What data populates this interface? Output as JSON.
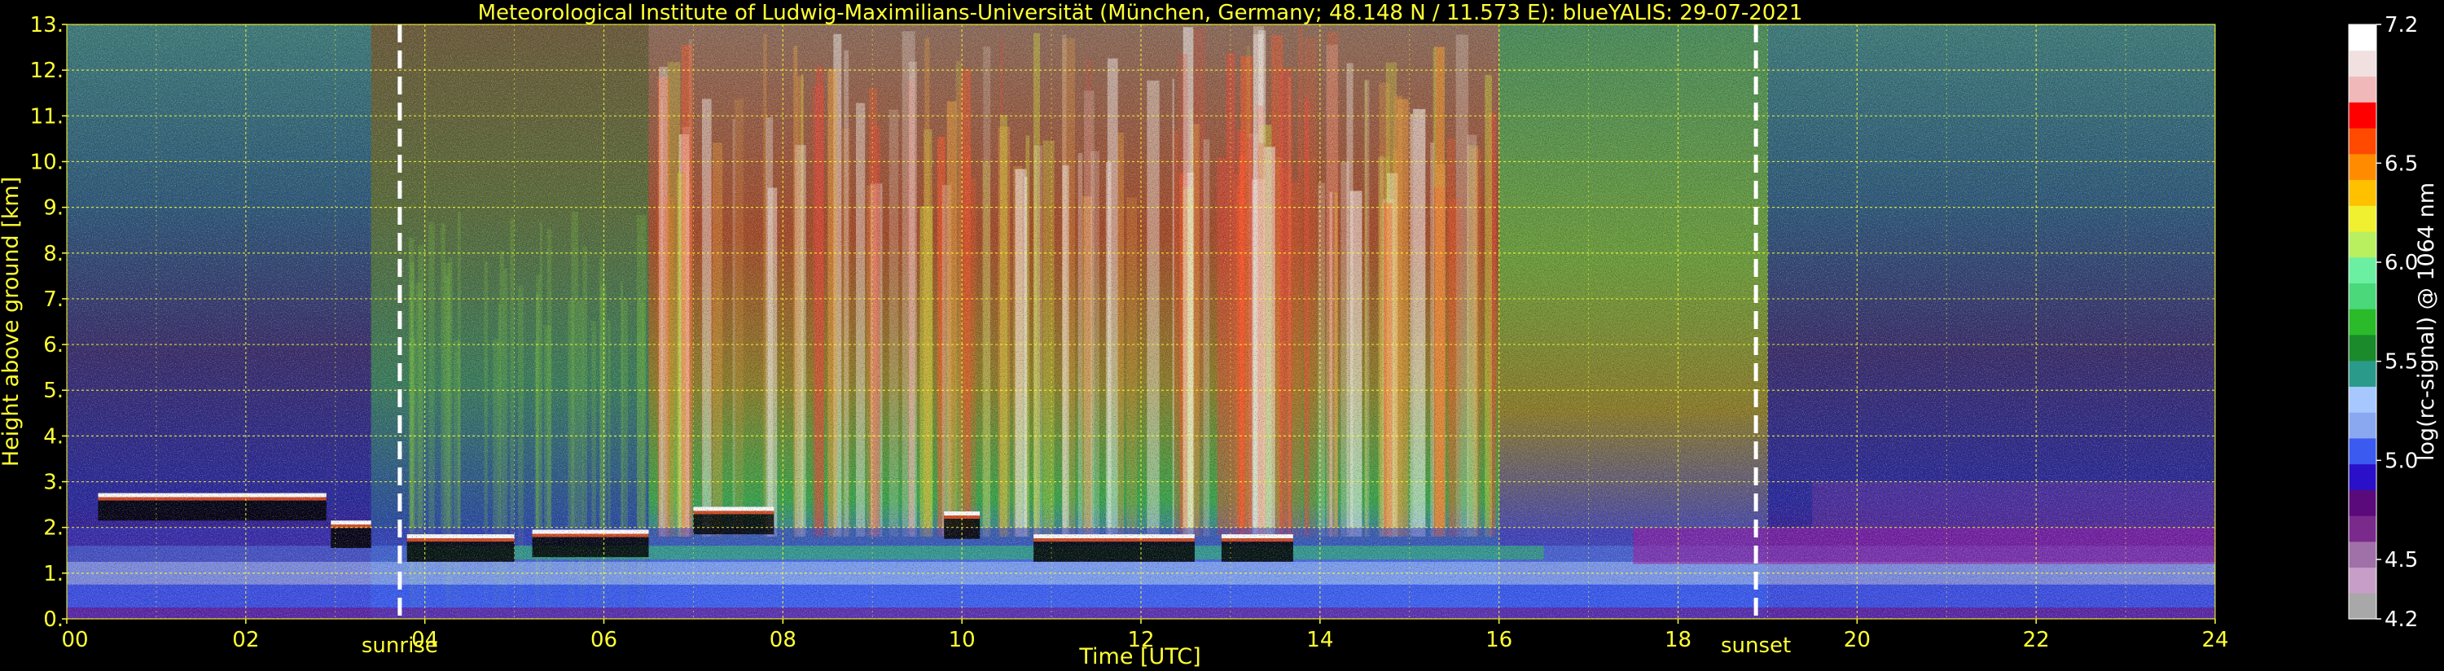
{
  "chart_data": {
    "type": "heatmap",
    "title": "Meteorological Institute of Ludwig-Maximilians-Universität (München, Germany; 48.148 N / 11.573 E):     blueYALIS: 29-07-2021",
    "xlabel": "Time [UTC]",
    "ylabel": "Height above ground [km]",
    "xlim": [
      0,
      24
    ],
    "ylim": [
      0,
      13
    ],
    "x_ticks": [
      "00",
      "02",
      "04",
      "06",
      "08",
      "10",
      "12",
      "14",
      "16",
      "18",
      "20",
      "22",
      "24"
    ],
    "y_ticks": [
      "0.",
      "1.",
      "2.",
      "3.",
      "4.",
      "5.",
      "6.",
      "7.",
      "8.",
      "9.",
      "10.",
      "11.",
      "12.",
      "13."
    ],
    "grid": true,
    "colorbar": {
      "label": "log(rc-signal) @ 1064 nm",
      "range": [
        4.2,
        7.2
      ],
      "ticks": [
        "4.2",
        "4.5",
        "5.0",
        "5.5",
        "6.0",
        "6.5",
        "7.2"
      ],
      "colors": [
        "#a8a8a8",
        "#c79ec7",
        "#a070a8",
        "#7a2a8a",
        "#5a0a7a",
        "#2a10c8",
        "#3a5af0",
        "#8aa8f0",
        "#a6c8ff",
        "#2a9a8a",
        "#1a8a2a",
        "#2aba2a",
        "#4ad87a",
        "#6af0a0",
        "#b8f060",
        "#f0f030",
        "#ffc000",
        "#ff8c00",
        "#ff4a00",
        "#ff0000",
        "#f0b8b8",
        "#f0e0e0",
        "#ffffff"
      ]
    },
    "annotations": [
      {
        "text": "sunrise",
        "x": 3.72
      },
      {
        "text": "sunset",
        "x": 18.87
      }
    ],
    "regions": [
      {
        "t0": 0.0,
        "t1": 3.4,
        "band": "night"
      },
      {
        "t0": 3.4,
        "t1": 6.5,
        "band": "morning"
      },
      {
        "t0": 6.5,
        "t1": 8.5,
        "band": "noisy"
      },
      {
        "t0": 8.5,
        "t1": 16.0,
        "band": "noisy"
      },
      {
        "t0": 16.0,
        "t1": 19.0,
        "band": "afternoon"
      },
      {
        "t0": 19.0,
        "t1": 24.0,
        "band": "night"
      }
    ],
    "cloud_segments": [
      {
        "t0": 0.35,
        "t1": 2.9,
        "h": 2.6
      },
      {
        "t0": 2.95,
        "t1": 3.4,
        "h": 2.0
      },
      {
        "t0": 3.8,
        "t1": 5.0,
        "h": 1.7
      },
      {
        "t0": 5.2,
        "t1": 6.5,
        "h": 1.8
      },
      {
        "t0": 7.0,
        "t1": 7.9,
        "h": 2.3
      },
      {
        "t0": 9.8,
        "t1": 10.2,
        "h": 2.2
      },
      {
        "t0": 10.8,
        "t1": 12.6,
        "h": 1.7
      },
      {
        "t0": 12.9,
        "t1": 13.7,
        "h": 1.7
      }
    ]
  }
}
